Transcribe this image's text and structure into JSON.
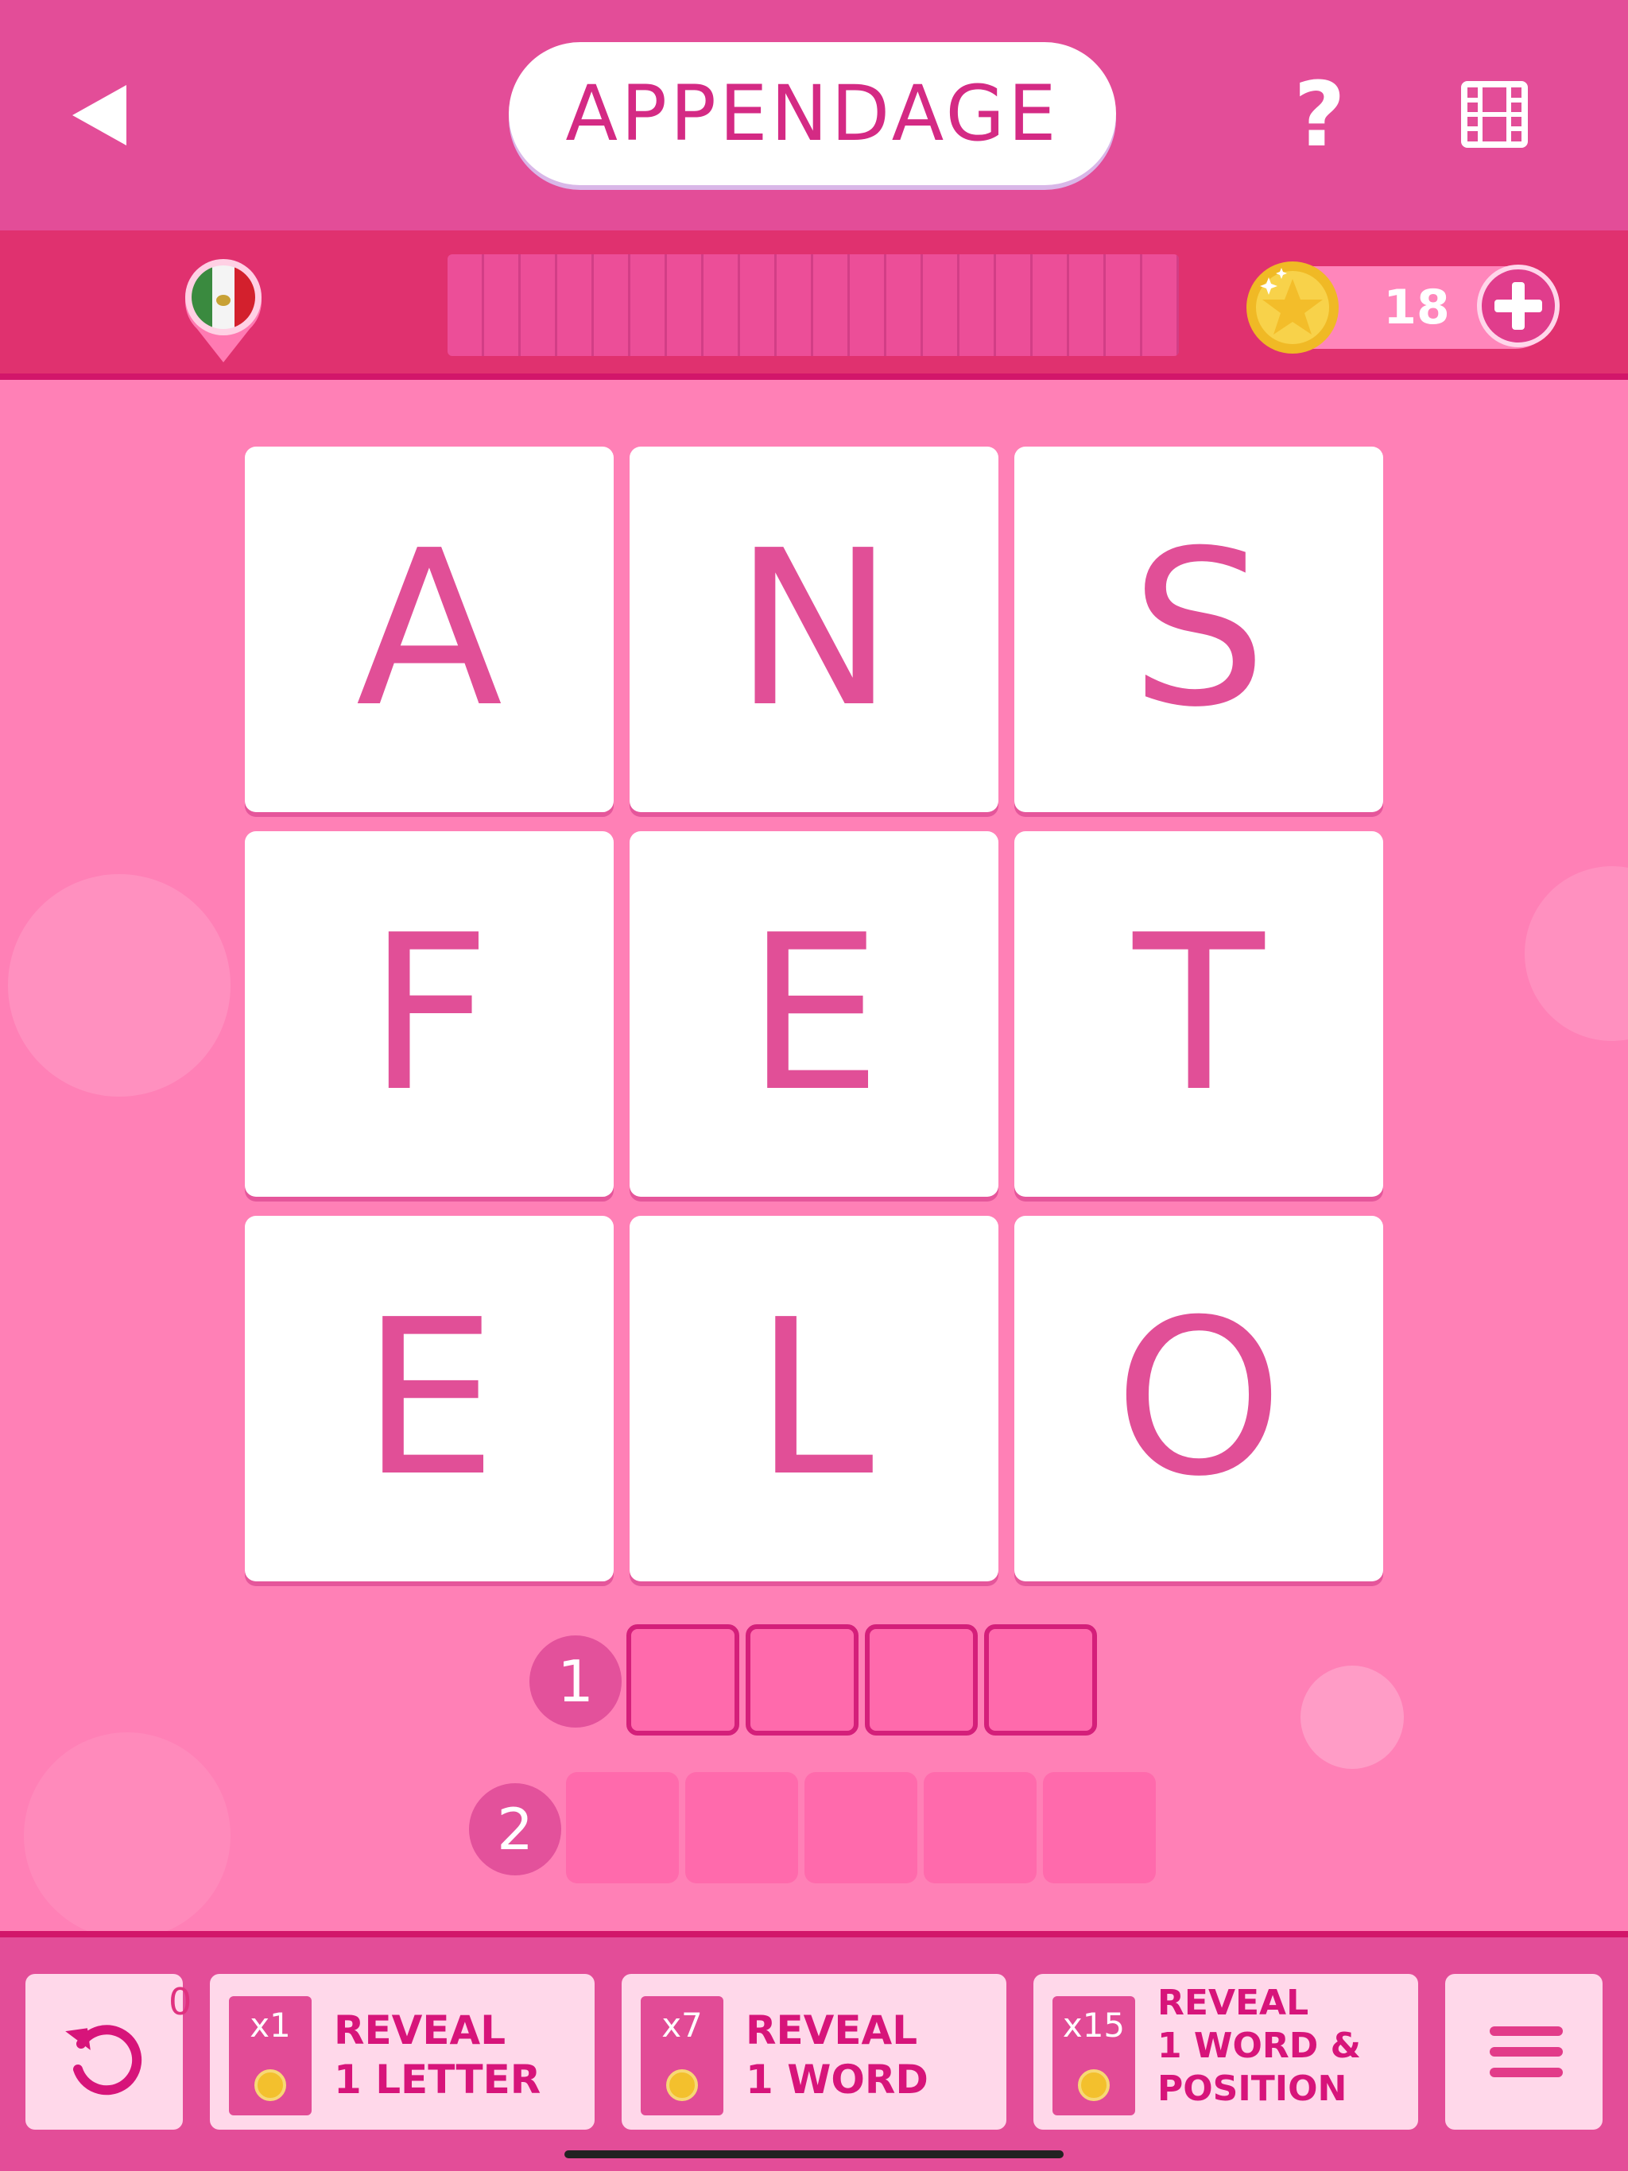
{
  "header": {
    "title": "APPENDAGE",
    "help_label": "?"
  },
  "status": {
    "coins": "18",
    "progress_fraction": 0,
    "progress_segments": 20
  },
  "grid": {
    "letters": [
      "A",
      "N",
      "S",
      "F",
      "E",
      "T",
      "E",
      "L",
      "O"
    ]
  },
  "words": [
    {
      "number": "1",
      "length": 4
    },
    {
      "number": "2",
      "length": 5
    }
  ],
  "footer": {
    "undo_count": "0",
    "reveal_letter": {
      "multiplier": "x1",
      "line1": "REVEAL",
      "line2": "1 LETTER"
    },
    "reveal_word": {
      "multiplier": "x7",
      "line1": "REVEAL",
      "line2": "1 WORD"
    },
    "reveal_position": {
      "multiplier": "x15",
      "line1": "REVEAL",
      "line2": "1 WORD &",
      "line3": "POSITION"
    }
  },
  "colors": {
    "accent": "#e34d98",
    "background": "#ff80b6",
    "letter": "#e14f97"
  },
  "icons": {
    "back": "back-arrow-icon",
    "video": "film-icon",
    "flag": "mexico-flag-pin-icon",
    "coin": "star-coin-icon",
    "undo": "undo-icon",
    "menu": "hamburger-menu-icon"
  }
}
